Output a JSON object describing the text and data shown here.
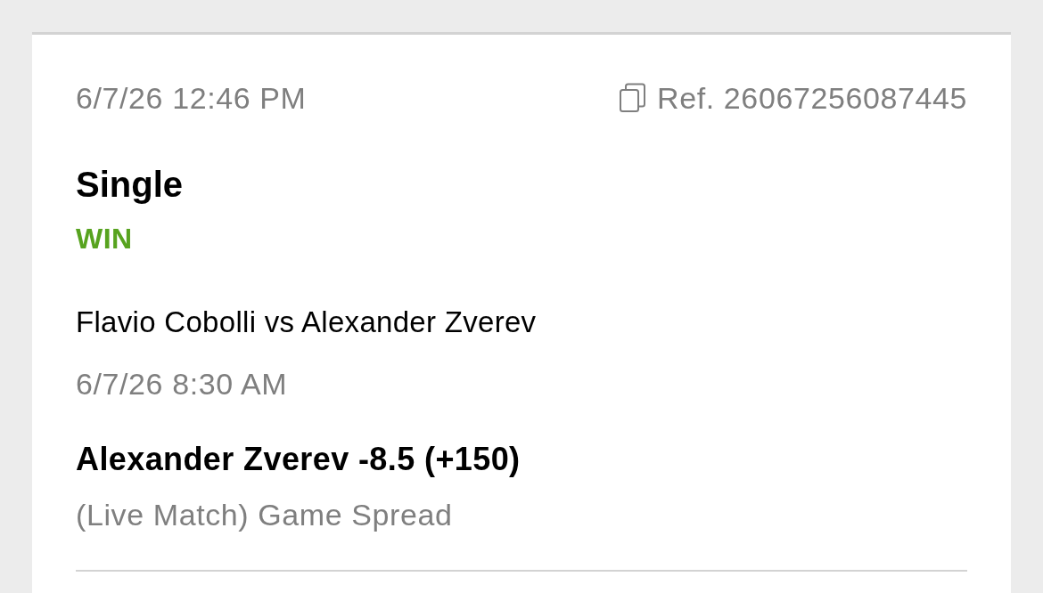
{
  "bet": {
    "placed_at": "6/7/26 12:46 PM",
    "reference": "Ref. 26067256087445",
    "type": "Single",
    "outcome": {
      "label": "WIN",
      "kind": "win"
    },
    "selections": [
      {
        "event": "Flavio Cobolli vs Alexander Zverev",
        "start_time": "6/7/26 8:30 AM",
        "pick": "Alexander Zverev -8.5 (+150)",
        "market": "(Live Match) Game Spread"
      }
    ]
  }
}
